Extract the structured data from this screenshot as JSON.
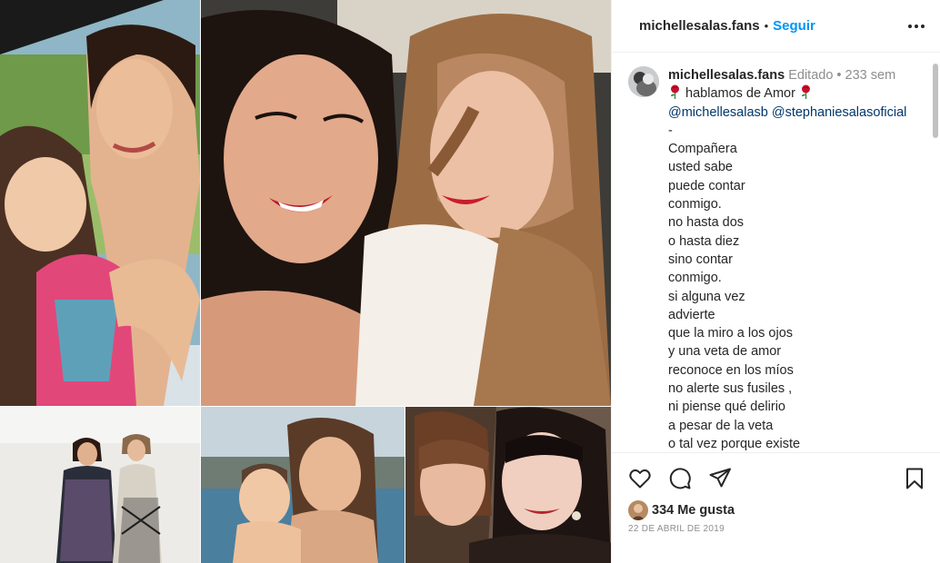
{
  "post": {
    "username": "michellesalas.fans",
    "separator": "•",
    "follow_label": "Seguir",
    "more_icon": "more-horizontal-icon"
  },
  "caption": {
    "username": "michellesalas.fans",
    "edited": "Editado",
    "dot": "•",
    "age": "233 sem",
    "title_text": "hablamos de Amor",
    "rose_icon": "rose-emoji-icon",
    "rose_color": "#c8102e",
    "mentions": [
      "@michellesalasb",
      "@stephaniesalasoficial"
    ],
    "lines": [
      "-",
      "Compañera",
      "usted sabe",
      "puede contar",
      "conmigo.",
      "no hasta dos",
      "o hasta diez",
      "sino contar",
      "conmigo.",
      "si alguna vez",
      "advierte",
      "que la miro a los ojos",
      "y una veta de amor",
      "reconoce en los míos",
      "no alerte sus fusiles ,",
      "ni piense qué delirio",
      "a pesar de la veta",
      "o tal vez porque existe"
    ]
  },
  "actions": {
    "like_icon": "heart-icon",
    "comment_icon": "comment-icon",
    "share_icon": "send-icon",
    "save_icon": "bookmark-icon",
    "likes": "334 Me gusta",
    "date": "22 DE ABRIL DE 2019"
  },
  "colors": {
    "link_blue": "#0095f6",
    "mention_blue": "#00376b",
    "meta_gray": "#8e8e8e",
    "text": "#262626"
  }
}
